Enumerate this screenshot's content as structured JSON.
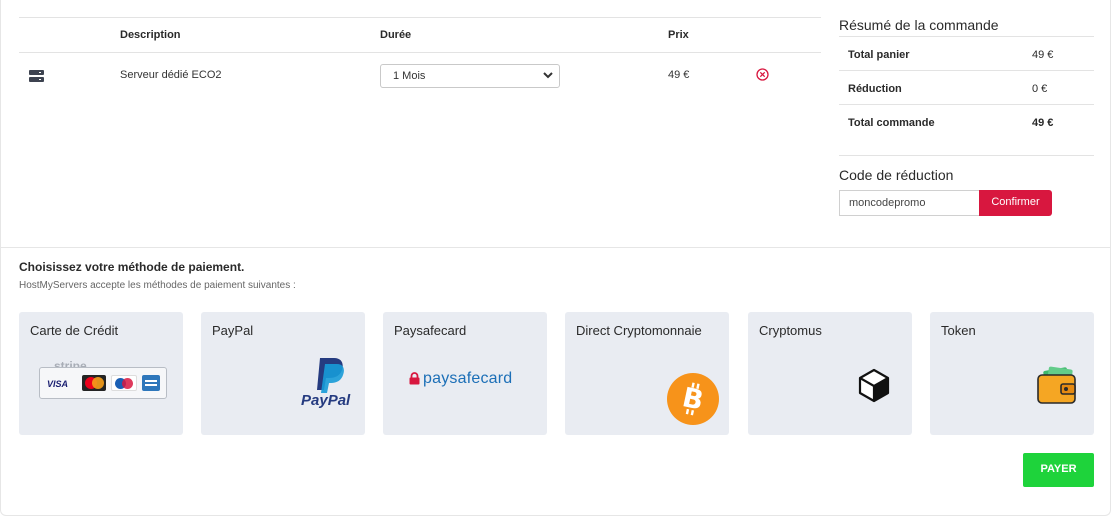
{
  "cart": {
    "headers": {
      "description": "Description",
      "duration": "Durée",
      "price": "Prix"
    },
    "item": {
      "icon": "server-icon",
      "description": "Serveur dédié ECO2",
      "duration_selected": "1 Mois",
      "price": "49 €",
      "remove_icon": "remove-circle-icon"
    }
  },
  "summary": {
    "title": "Résumé de la commande",
    "rows": [
      {
        "label": "Total panier",
        "value": "49 €"
      },
      {
        "label": "Réduction",
        "value": "0 €"
      },
      {
        "label": "Total commande",
        "value": "49 €"
      }
    ]
  },
  "promo": {
    "title": "Code de réduction",
    "value": "moncodepromo",
    "button": "Confirmer"
  },
  "payment": {
    "title": "Choisissez votre méthode de paiement.",
    "subtitle": "HostMyServers accepte les méthodes de paiement suivantes :",
    "methods": [
      {
        "label": "Carte de Crédit",
        "logo_text": "stripe",
        "card_brands": [
          "VISA",
          "MasterCard",
          "Maestro",
          "AMEX"
        ]
      },
      {
        "label": "PayPal",
        "logo_text": "PayPal"
      },
      {
        "label": "Paysafecard",
        "logo_text": "paysafecard"
      },
      {
        "label": "Direct Cryptomonnaie",
        "icon": "bitcoin-icon"
      },
      {
        "label": "Cryptomus",
        "icon": "cube-icon"
      },
      {
        "label": "Token",
        "icon": "wallet-icon"
      }
    ],
    "submit": "PAYER"
  },
  "colors": {
    "accent_red": "#d8173f",
    "pay_green": "#1ed33b",
    "card_bg": "#e9ecf2",
    "bitcoin_orange": "#f7931a",
    "paysafe_blue": "#1c6fb7",
    "paypal_dark": "#253b80",
    "paypal_light": "#179bd7",
    "wallet_orange": "#f5a623"
  }
}
